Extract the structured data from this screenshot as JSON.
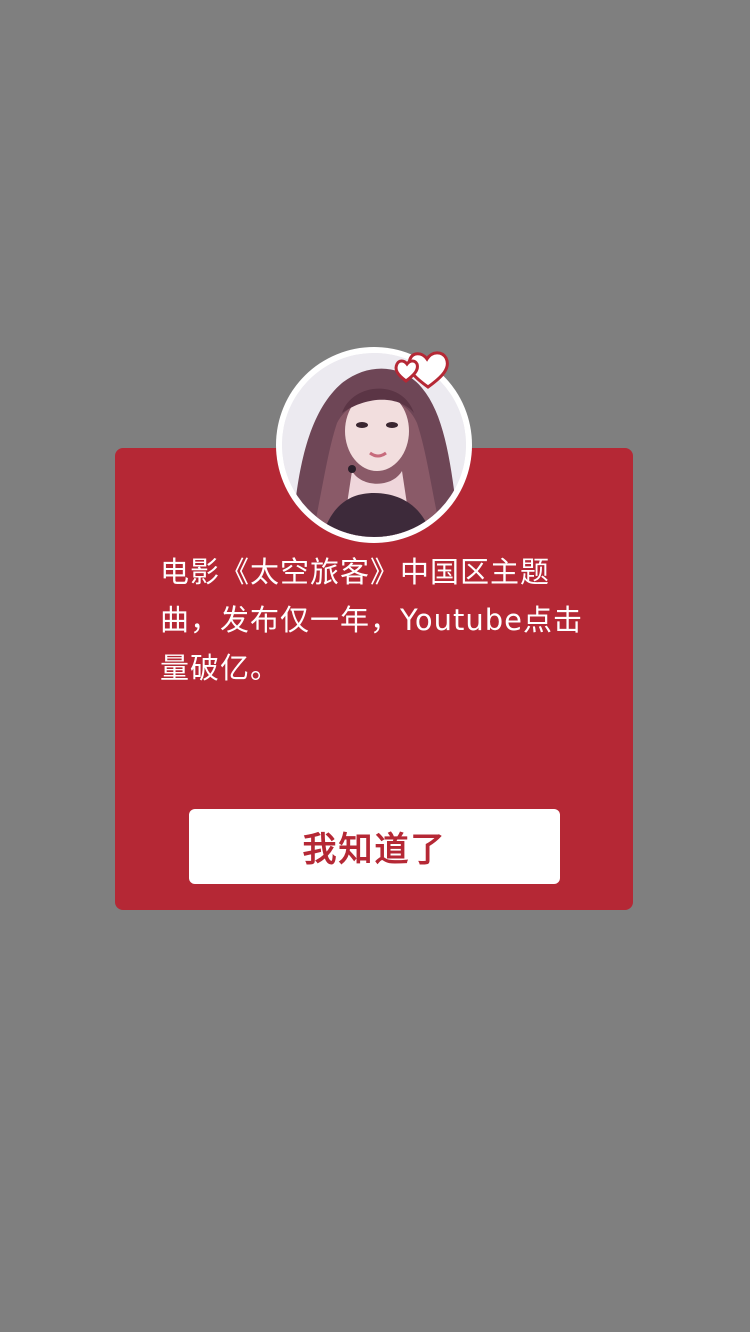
{
  "dialog": {
    "message": "电影《太空旅客》中国区主题曲，发布仅一年，Youtube点击量破亿。",
    "confirm_label": "我知道了"
  },
  "colors": {
    "backdrop": "#7f7f7f",
    "card": "#b52835",
    "button_bg": "#ffffff",
    "button_text": "#b52835",
    "message_text": "#ffffff"
  },
  "icons": {
    "avatar": "singer-portrait-photo",
    "decoration": "double-heart-icon"
  }
}
